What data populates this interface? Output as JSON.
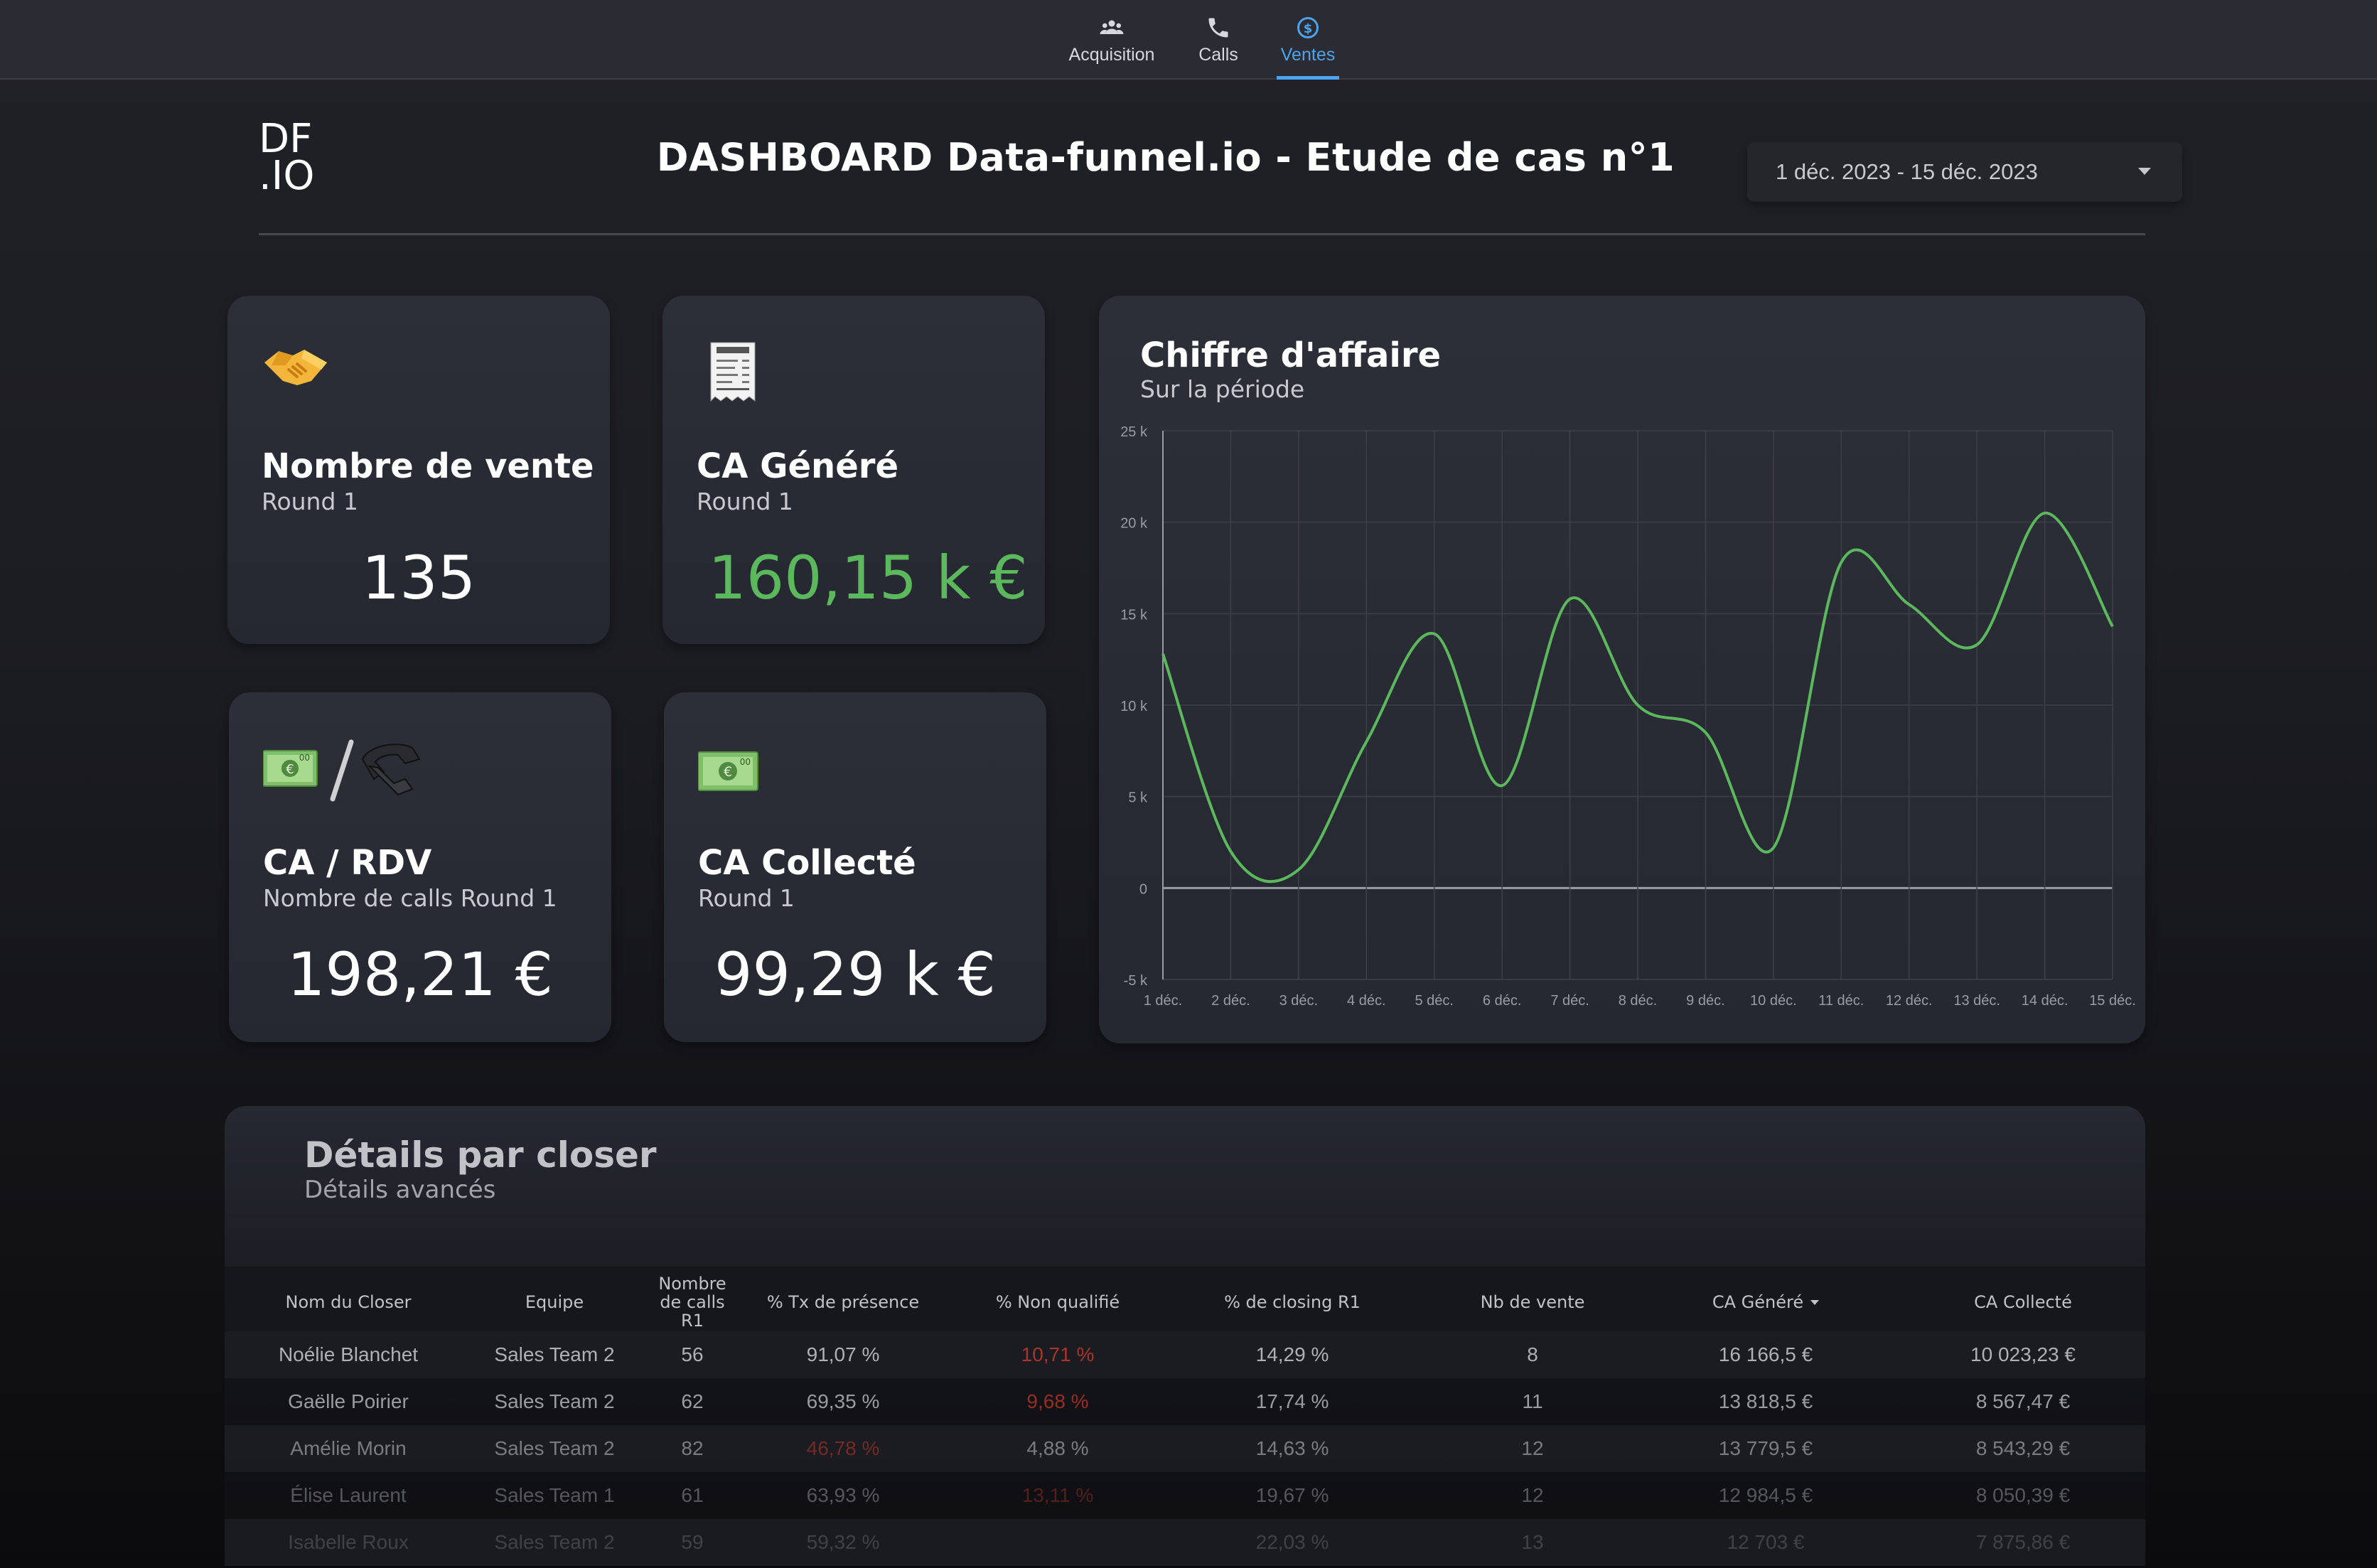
{
  "nav": {
    "tabs": [
      {
        "label": "Acquisition",
        "icon": "people-icon",
        "active": false
      },
      {
        "label": "Calls",
        "icon": "phone-icon",
        "active": false
      },
      {
        "label": "Ventes",
        "icon": "dollar-circle-icon",
        "active": true
      }
    ]
  },
  "header": {
    "logo_top": "DF",
    "logo_bottom": ".IO",
    "title": "DASHBOARD Data-funnel.io - Etude de cas n°1",
    "date_range": "1 déc. 2023 - 15 déc. 2023"
  },
  "cards": {
    "nombre_vente": {
      "icon": "handshake-icon",
      "title": "Nombre de vente",
      "subtitle": "Round 1",
      "value": "135"
    },
    "ca_genere": {
      "icon": "receipt-icon",
      "title": "CA Généré",
      "subtitle": "Round 1",
      "value": "160,15 k €",
      "value_color": "#5cb85c"
    },
    "ca_rdv": {
      "icon": "money-phone-icon",
      "title": "CA / RDV",
      "subtitle": "Nombre de calls Round 1",
      "value": "198,21 €"
    },
    "ca_collecte": {
      "icon": "money-icon",
      "title": "CA Collecté",
      "subtitle": "Round 1",
      "value": "99,29 k €"
    }
  },
  "chart_card": {
    "title": "Chiffre d'affaire",
    "subtitle": "Sur la période"
  },
  "chart_data": {
    "type": "line",
    "x": [
      "1 déc.",
      "2 déc.",
      "3 déc.",
      "4 déc.",
      "5 déc.",
      "6 déc.",
      "7 déc.",
      "8 déc.",
      "9 déc.",
      "10 déc.",
      "11 déc.",
      "12 déc.",
      "13 déc.",
      "14 déc.",
      "15 déc."
    ],
    "series": [
      {
        "values": [
          12800,
          2000,
          1000,
          8000,
          13900,
          5600,
          15800,
          10000,
          8500,
          2200,
          17800,
          15500,
          13300,
          20500,
          14300
        ]
      }
    ],
    "ylim": [
      -5000,
      25000
    ],
    "yticks": [
      25000,
      20000,
      15000,
      10000,
      5000,
      0,
      -5000
    ],
    "ytick_labels": [
      "25 k",
      "20 k",
      "15 k",
      "10 k",
      "5 k",
      "0",
      "-5 k"
    ],
    "line_color": "#5cb85c",
    "grid": true
  },
  "details": {
    "title": "Détails par closer",
    "subtitle": "Détails avancés",
    "columns": [
      "Nom du Closer",
      "Equipe",
      "Nombre de calls R1",
      "% Tx de présence",
      "% Non qualifié",
      "% de closing R1",
      "Nb de vente",
      "CA Généré",
      "CA Collecté"
    ],
    "rows": [
      [
        "Noélie Blanchet",
        "Sales Team 2",
        "56",
        "91,07 %",
        "10,71 %",
        "14,29 %",
        "8",
        "16 166,5 €",
        "10 023,23 €"
      ],
      [
        "Gaëlle Poirier",
        "Sales Team 2",
        "62",
        "69,35 %",
        "9,68 %",
        "17,74 %",
        "11",
        "13 818,5 €",
        "8 567,47 €"
      ],
      [
        "Amélie Morin",
        "Sales Team 2",
        "82",
        "46,78 %",
        "4,88 %",
        "14,63 %",
        "12",
        "13 779,5 €",
        "8 543,29 €"
      ],
      [
        "Élise Laurent",
        "Sales Team 1",
        "61",
        "63,93 %",
        "13,11 %",
        "19,67 %",
        "12",
        "12 984,5 €",
        "8 050,39 €"
      ],
      [
        "Isabelle Roux",
        "Sales Team 2",
        "59",
        "59,32 %",
        "",
        "22,03 %",
        "13",
        "12 703 €",
        "7 875,86 €"
      ]
    ],
    "red_color": "#c0392b"
  }
}
